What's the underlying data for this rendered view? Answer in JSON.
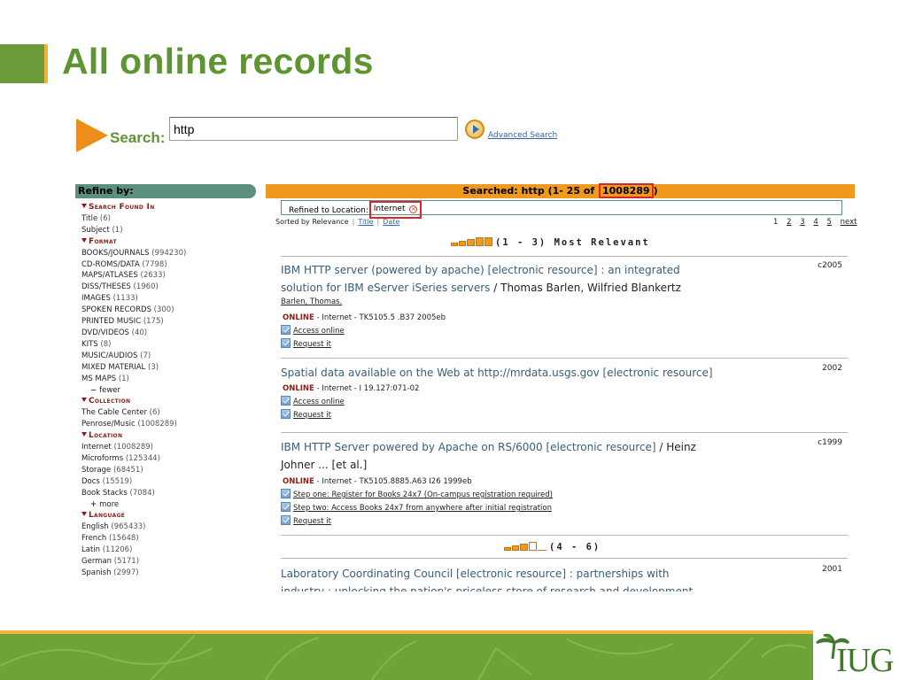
{
  "slide": {
    "title": "All online records"
  },
  "search": {
    "label": "Search:",
    "value": "http",
    "advanced_label": "Advanced Search"
  },
  "refine": {
    "header": "Refine by:",
    "groups": [
      {
        "label": "Search Found In",
        "items": [
          {
            "name": "Title",
            "count": "(6)"
          },
          {
            "name": "Subject",
            "count": "(1)"
          }
        ]
      },
      {
        "label": "Format",
        "items": [
          {
            "name": "BOOKS/JOURNALS",
            "count": "(994230)"
          },
          {
            "name": "CD-ROMS/DATA",
            "count": "(7798)"
          },
          {
            "name": "MAPS/ATLASES",
            "count": "(2633)"
          },
          {
            "name": "DISS/THESES",
            "count": "(1960)"
          },
          {
            "name": "IMAGES",
            "count": "(1133)"
          },
          {
            "name": "SPOKEN RECORDS",
            "count": "(300)"
          },
          {
            "name": "PRINTED MUSIC",
            "count": "(175)"
          },
          {
            "name": "DVD/VIDEOS",
            "count": "(40)"
          },
          {
            "name": "KITS",
            "count": "(8)"
          },
          {
            "name": "MUSIC/AUDIOS",
            "count": "(7)"
          },
          {
            "name": "MIXED MATERIAL",
            "count": "(3)"
          },
          {
            "name": "MS MAPS",
            "count": "(1)"
          }
        ],
        "toggle": {
          "symbol": "−",
          "label": "fewer"
        }
      },
      {
        "label": "Collection",
        "items": [
          {
            "name": "The Cable Center",
            "count": "(6)"
          },
          {
            "name": "Penrose/Music",
            "count": "(1008289)"
          }
        ]
      },
      {
        "label": "Location",
        "items": [
          {
            "name": "Internet",
            "count": "(1008289)"
          },
          {
            "name": "Microforms",
            "count": "(125344)"
          },
          {
            "name": "Storage",
            "count": "(68451)"
          },
          {
            "name": "Docs",
            "count": "(15519)"
          },
          {
            "name": "Book Stacks",
            "count": "(7084)"
          }
        ],
        "toggle": {
          "symbol": "+",
          "label": "more"
        }
      },
      {
        "label": "Language",
        "items": [
          {
            "name": "English",
            "count": "(965433)"
          },
          {
            "name": "French",
            "count": "(15648)"
          },
          {
            "name": "Latin",
            "count": "(11206)"
          },
          {
            "name": "German",
            "count": "(5171)"
          },
          {
            "name": "Spanish",
            "count": "(2997)"
          }
        ]
      }
    ]
  },
  "results": {
    "searched_prefix": "Searched: http (1- 25  of ",
    "total": "1008289",
    "searched_suffix": ")",
    "refined_label": "Refined to Location:",
    "refined_value": "Internet",
    "sorted_by": "Sorted by",
    "sort_relevance": "Relevance",
    "sort_title": "Title",
    "sort_date": "Date",
    "pages": [
      "1",
      "2",
      "3",
      "4",
      "5"
    ],
    "next_label": "next",
    "group1": "(1 - 3) Most Relevant",
    "group2": "(4 - 6)",
    "records": [
      {
        "title": "IBM HTTP server (powered by apache) [electronic resource] : an integrated solution for IBM eServer iSeries servers",
        "resp": " / Thomas Barlen, Wilfried Blankertz",
        "author": "Barlen, Thomas.",
        "year": "c2005",
        "status": "ONLINE",
        "holding": " - Internet - TK5105.5 .B37 2005eb",
        "links": [
          "Access online",
          "Request it"
        ]
      },
      {
        "title": "Spatial data available on the Web at http://mrdata.usgs.gov [electronic resource]",
        "resp": "",
        "year": "2002",
        "status": "ONLINE",
        "holding": " - Internet - I 19.127:071-02",
        "links": [
          "Access online",
          "Request it"
        ]
      },
      {
        "title": "IBM HTTP Server powered by Apache on RS/6000 [electronic resource]",
        "resp": " / Heinz Johner ... [et al.]",
        "year": "c1999",
        "status": "ONLINE",
        "holding": " - Internet - TK5105.8885.A63 I26 1999eb",
        "links": [
          "Step one: Register for Books 24x7 (On-campus registration required)",
          "Step two: Access Books 24x7 from anywhere after initial registration",
          "Request it"
        ]
      },
      {
        "title": "Laboratory Coordinating Council [electronic resource] : partnerships with industry : unlocking the nation's priceless store of research and development",
        "resp": "",
        "year": "2001"
      }
    ]
  },
  "footer": {
    "logo_text": "IUG"
  }
}
